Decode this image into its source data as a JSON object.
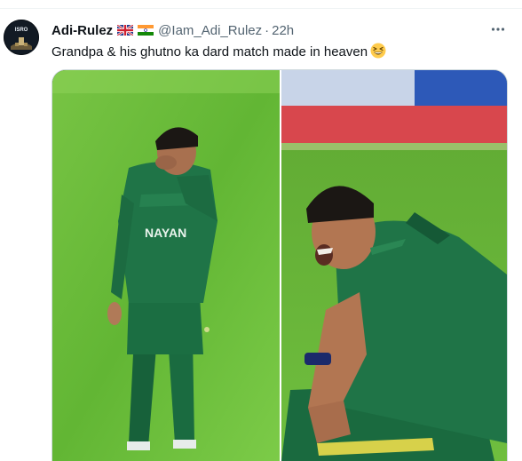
{
  "tweet": {
    "display_name": "Adi-Rulez",
    "handle": "@Iam_Adi_Rulez",
    "separator": "·",
    "time": "22h",
    "flags": [
      "uk-flag-icon",
      "india-flag-icon"
    ],
    "text": "Grandpa & his ghutno ka dard match made in heaven",
    "emoji": "grinning-squinting-face-icon",
    "more_icon": "more-options-icon"
  },
  "avatar": {
    "badge_text": "ISRO"
  },
  "media": {
    "left_panel": {
      "jersey_text": "NAYAN"
    },
    "colors": {
      "jersey": "#1c6e3f",
      "grass": "#6fbf3c",
      "stadium_red": "#d8474d"
    }
  }
}
